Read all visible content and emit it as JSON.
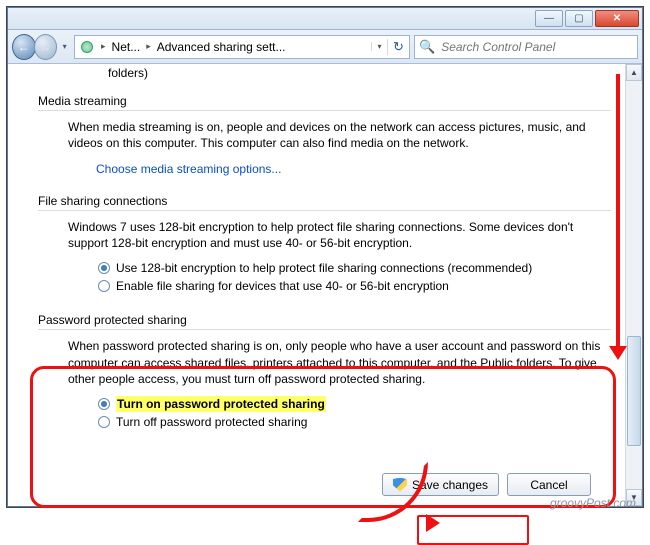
{
  "titlebar": {
    "minimize": "—",
    "maximize": "▢",
    "close": "✕"
  },
  "nav": {
    "back": "←",
    "forward": "→",
    "dropdown": "▾",
    "refresh": "↻",
    "addr_dropdown": "▾",
    "arrow_right": "▸",
    "breadcrumb": {
      "root_abbrev": "Net...",
      "current": "Advanced sharing sett..."
    }
  },
  "search": {
    "icon": "🔍",
    "placeholder": "Search Control Panel"
  },
  "fragments": {
    "folders_trailing": "folders)"
  },
  "sections": {
    "media": {
      "title": "Media streaming",
      "body": "When media streaming is on, people and devices on the network can access pictures, music, and videos on this computer. This computer can also find media on the network.",
      "link": "Choose media streaming options..."
    },
    "file_sharing": {
      "title": "File sharing connections",
      "body": "Windows 7 uses 128-bit encryption to help protect file sharing connections. Some devices don't support 128-bit encryption and must use 40- or 56-bit encryption.",
      "radio_128": "Use 128-bit encryption to help protect file sharing connections (recommended)",
      "radio_4056": "Enable file sharing for devices that use 40- or 56-bit encryption"
    },
    "password": {
      "title": "Password protected sharing",
      "body": "When password protected sharing is on, only people who have a user account and password on this computer can access shared files, printers attached to this computer, and the Public folders. To give other people access, you must turn off password protected sharing.",
      "radio_on": "Turn on password protected sharing",
      "radio_off": "Turn off password protected sharing"
    }
  },
  "buttons": {
    "save": "Save changes",
    "cancel": "Cancel"
  },
  "scrollbar": {
    "up": "▲",
    "down": "▼"
  },
  "watermark": "groovyPost.com"
}
